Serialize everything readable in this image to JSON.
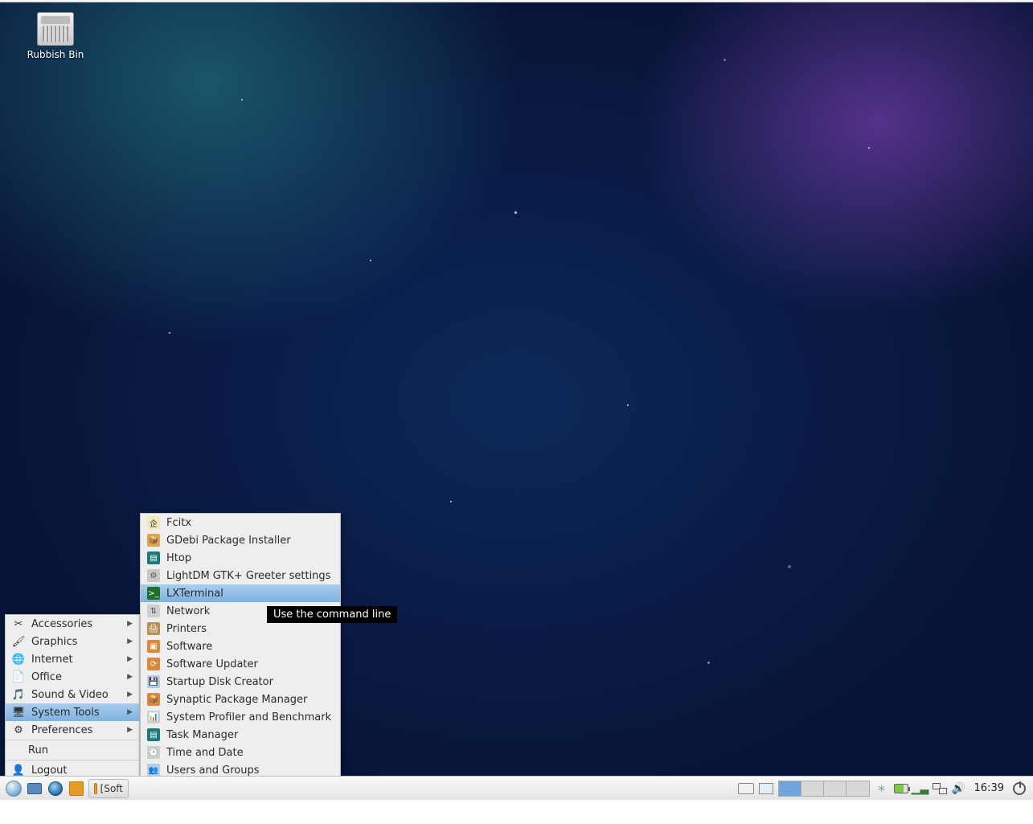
{
  "desktop": {
    "trash_label": "Rubbish Bin"
  },
  "main_menu": {
    "items": [
      {
        "label": "Accessories",
        "has_sub": true
      },
      {
        "label": "Graphics",
        "has_sub": true
      },
      {
        "label": "Internet",
        "has_sub": true
      },
      {
        "label": "Office",
        "has_sub": true
      },
      {
        "label": "Sound & Video",
        "has_sub": true
      },
      {
        "label": "System Tools",
        "has_sub": true,
        "active": true
      },
      {
        "label": "Preferences",
        "has_sub": true
      }
    ],
    "run_label": "Run",
    "logout_label": "Logout"
  },
  "submenu": {
    "items": [
      {
        "label": "Fcitx"
      },
      {
        "label": "GDebi Package Installer"
      },
      {
        "label": "Htop"
      },
      {
        "label": "LightDM GTK+ Greeter settings"
      },
      {
        "label": "LXTerminal",
        "active": true
      },
      {
        "label": "Network"
      },
      {
        "label": "Printers"
      },
      {
        "label": "Software"
      },
      {
        "label": "Software Updater"
      },
      {
        "label": "Startup Disk Creator"
      },
      {
        "label": "Synaptic Package Manager"
      },
      {
        "label": "System Profiler and Benchmark"
      },
      {
        "label": "Task Manager"
      },
      {
        "label": "Time and Date"
      },
      {
        "label": "Users and Groups"
      }
    ]
  },
  "tooltip": "Use the command line",
  "panel": {
    "task_label": "[Soft",
    "clock": "16:39",
    "workspaces": 4,
    "current_workspace": 0
  }
}
